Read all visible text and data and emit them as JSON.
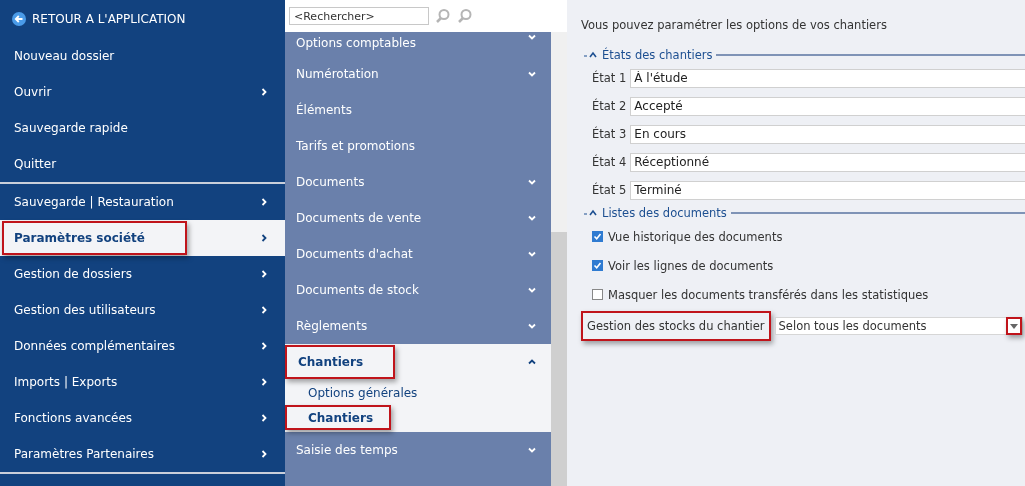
{
  "sidebar": {
    "back": "RETOUR A L'APPLICATION",
    "groups": [
      [
        {
          "label": "Nouveau dossier",
          "submenu": false,
          "selected": false,
          "highlighted": false
        },
        {
          "label": "Ouvrir",
          "submenu": true,
          "selected": false,
          "highlighted": false
        },
        {
          "label": "Sauvegarde rapide",
          "submenu": false,
          "selected": false,
          "highlighted": false
        },
        {
          "label": "Quitter",
          "submenu": false,
          "selected": false,
          "highlighted": false
        }
      ],
      [
        {
          "label": "Sauvegarde | Restauration",
          "submenu": true,
          "selected": false,
          "highlighted": false
        },
        {
          "label": "Paramètres société",
          "submenu": true,
          "selected": true,
          "highlighted": true
        },
        {
          "label": "Gestion de dossiers",
          "submenu": true,
          "selected": false,
          "highlighted": false
        },
        {
          "label": "Gestion des utilisateurs",
          "submenu": true,
          "selected": false,
          "highlighted": false
        },
        {
          "label": "Données complémentaires",
          "submenu": true,
          "selected": false,
          "highlighted": false
        },
        {
          "label": "Imports | Exports",
          "submenu": true,
          "selected": false,
          "highlighted": false
        },
        {
          "label": "Fonctions avancées",
          "submenu": true,
          "selected": false,
          "highlighted": false
        },
        {
          "label": "Paramètres Partenaires",
          "submenu": true,
          "selected": false,
          "highlighted": false
        }
      ]
    ]
  },
  "navigator": {
    "search": {
      "placeholder": "<Rechercher>"
    },
    "items": [
      {
        "label": "Options comptables",
        "expandable": true,
        "expanded": false,
        "highlighted": false
      },
      {
        "label": "Numérotation",
        "expandable": true,
        "expanded": false,
        "highlighted": false
      },
      {
        "label": "Éléments",
        "expandable": false,
        "expanded": false,
        "highlighted": false
      },
      {
        "label": "Tarifs et promotions",
        "expandable": false,
        "expanded": false,
        "highlighted": false
      },
      {
        "label": "Documents",
        "expandable": true,
        "expanded": false,
        "highlighted": false
      },
      {
        "label": "Documents de vente",
        "expandable": true,
        "expanded": false,
        "highlighted": false
      },
      {
        "label": "Documents d'achat",
        "expandable": true,
        "expanded": false,
        "highlighted": false
      },
      {
        "label": "Documents de stock",
        "expandable": true,
        "expanded": false,
        "highlighted": false
      },
      {
        "label": "Règlements",
        "expandable": true,
        "expanded": false,
        "highlighted": false
      },
      {
        "label": "Chantiers",
        "expandable": true,
        "expanded": true,
        "highlighted": true,
        "children": [
          {
            "label": "Options générales",
            "selected": false,
            "highlighted": false
          },
          {
            "label": "Chantiers",
            "selected": true,
            "highlighted": true
          }
        ]
      },
      {
        "label": "Saisie des temps",
        "expandable": true,
        "expanded": false,
        "highlighted": false
      }
    ]
  },
  "content": {
    "intro": "Vous pouvez paramétrer les options de vos chantiers",
    "states_section": {
      "title": "États des chantiers",
      "expanded": true,
      "fields": [
        {
          "label": "État 1",
          "value": "À l'étude"
        },
        {
          "label": "État 2",
          "value": "Accepté"
        },
        {
          "label": "État 3",
          "value": "En cours"
        },
        {
          "label": "État 4",
          "value": "Réceptionné"
        },
        {
          "label": "État 5",
          "value": "Terminé"
        }
      ]
    },
    "lists_section": {
      "title": "Listes des documents",
      "expanded": true,
      "checkboxes": [
        {
          "label": "Vue historique des documents",
          "checked": true
        },
        {
          "label": "Voir les lignes de documents",
          "checked": true
        },
        {
          "label": "Masquer les documents transférés dans les statistiques",
          "checked": false
        }
      ],
      "stock": {
        "label": "Gestion des stocks du chantier",
        "value": "Selon tous les documents",
        "highlighted": true
      }
    }
  }
}
